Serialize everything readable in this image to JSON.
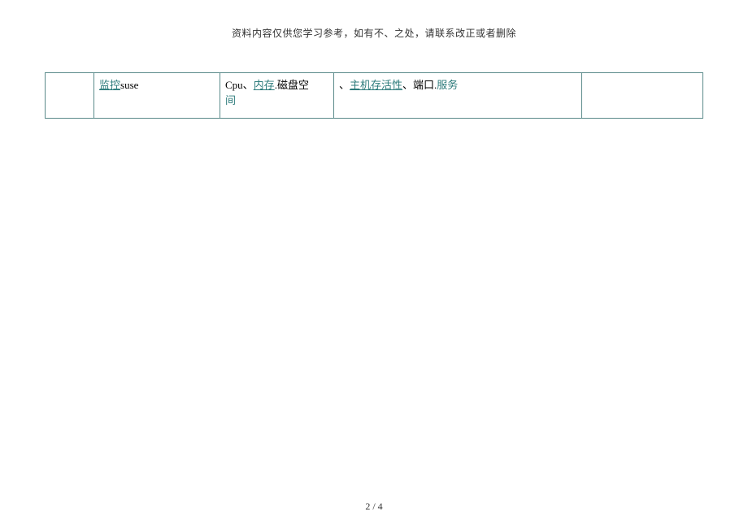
{
  "header": {
    "disclaimer": "资料内容仅供您学习参考，如有不、之处，请联系改正或者删除"
  },
  "table": {
    "row": {
      "col2_link": "监控",
      "col2_plain": "suse",
      "col3_line1_plain": " Cpu、",
      "col3_line1_link": "内存",
      "col3_line1_after": ".磁盘空",
      "col3_line2": "间",
      "col4_prefix": "、",
      "col4_link": "主机存活性",
      "col4_mid": "、端口.",
      "col4_suffix": "服务"
    }
  },
  "footer": {
    "page": "2 / 4"
  }
}
